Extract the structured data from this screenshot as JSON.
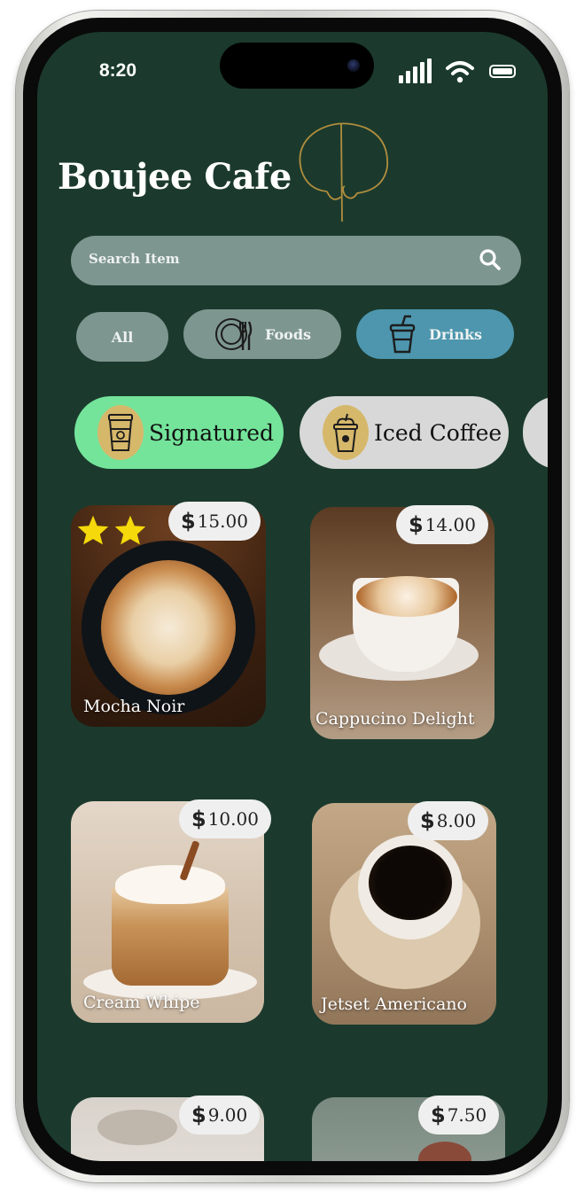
{
  "status_bar": {
    "time": "8:20"
  },
  "header": {
    "title": "Boujee Cafe"
  },
  "search": {
    "placeholder": "Search Item"
  },
  "filters": [
    {
      "label": "All",
      "icon": "none",
      "selected": false
    },
    {
      "label": "Foods",
      "icon": "plate-fork-knife-icon",
      "selected": false
    },
    {
      "label": "Drinks",
      "icon": "cup-straw-icon",
      "selected": true
    }
  ],
  "categories": [
    {
      "label": "Signatured",
      "icon": "coffee-cup-icon",
      "selected": true
    },
    {
      "label": "Iced Coffee",
      "icon": "iced-coffee-icon",
      "selected": false
    },
    {
      "label": "",
      "icon": "",
      "selected": false
    }
  ],
  "products": [
    {
      "name": "Mocha Noir",
      "price": "15.00",
      "currency": "$",
      "stars": 2
    },
    {
      "name": "Cappucino Delight",
      "price": "14.00",
      "currency": "$"
    },
    {
      "name": "Cream Whipe",
      "price": "10.00",
      "currency": "$"
    },
    {
      "name": "Jetset Americano",
      "price": "8.00",
      "currency": "$"
    },
    {
      "name": "",
      "price": "9.00",
      "currency": "$"
    },
    {
      "name": "",
      "price": "7.50",
      "currency": "$"
    }
  ],
  "colors": {
    "background": "#1b3a2d",
    "search_bg": "#7e9690",
    "filter_selected": "#4d96ae",
    "category_selected": "#74e49b",
    "category_default": "#d8d8d8",
    "star": "#f5d90a",
    "logo_gold": "#b08d3e"
  }
}
